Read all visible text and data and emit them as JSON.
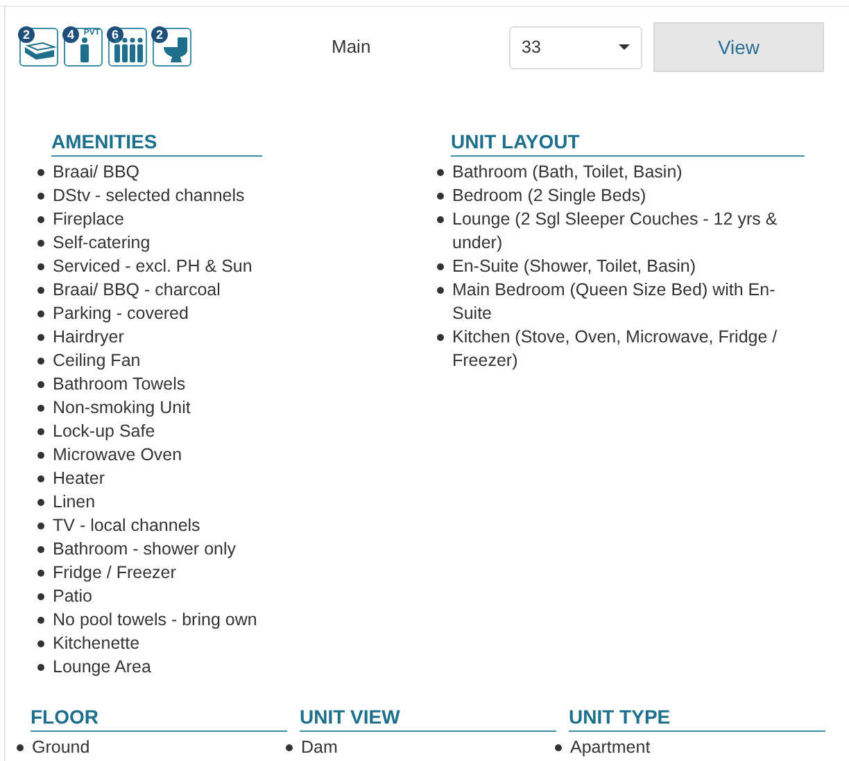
{
  "facilities": [
    {
      "kind": "bed",
      "count": "2"
    },
    {
      "kind": "person",
      "count": "4",
      "label": "PVT"
    },
    {
      "kind": "people",
      "count": "6"
    },
    {
      "kind": "toilet",
      "count": "2"
    }
  ],
  "unit_name": "Main",
  "unit_select": {
    "value": "33"
  },
  "view_button": "View",
  "amenities": {
    "title": "AMENITIES",
    "items": [
      "Braai/ BBQ",
      "DStv - selected channels",
      "Fireplace",
      "Self-catering",
      "Serviced - excl. PH & Sun",
      "Braai/ BBQ - charcoal",
      "Parking - covered",
      "Hairdryer",
      "Ceiling Fan",
      "Bathroom Towels",
      "Non-smoking Unit",
      "Lock-up Safe",
      "Microwave Oven",
      "Heater",
      "Linen",
      "TV - local channels",
      "Bathroom - shower only",
      "Fridge / Freezer",
      "Patio",
      "No pool towels - bring own",
      "Kitchenette",
      "Lounge Area"
    ]
  },
  "unit_layout": {
    "title": "UNIT LAYOUT",
    "items": [
      "Bathroom (Bath, Toilet, Basin)",
      "Bedroom (2 Single Beds)",
      "Lounge (2 Sgl Sleeper Couches - 12 yrs & under)",
      "En-Suite (Shower, Toilet, Basin)",
      "Main Bedroom (Queen Size Bed) with En-Suite",
      "Kitchen (Stove, Oven, Microwave, Fridge / Freezer)"
    ]
  },
  "details": [
    {
      "title": "FLOOR",
      "items": [
        "Ground"
      ]
    },
    {
      "title": "UNIT VIEW",
      "items": [
        "Dam"
      ]
    },
    {
      "title": "UNIT TYPE",
      "items": [
        "Apartment"
      ]
    }
  ]
}
